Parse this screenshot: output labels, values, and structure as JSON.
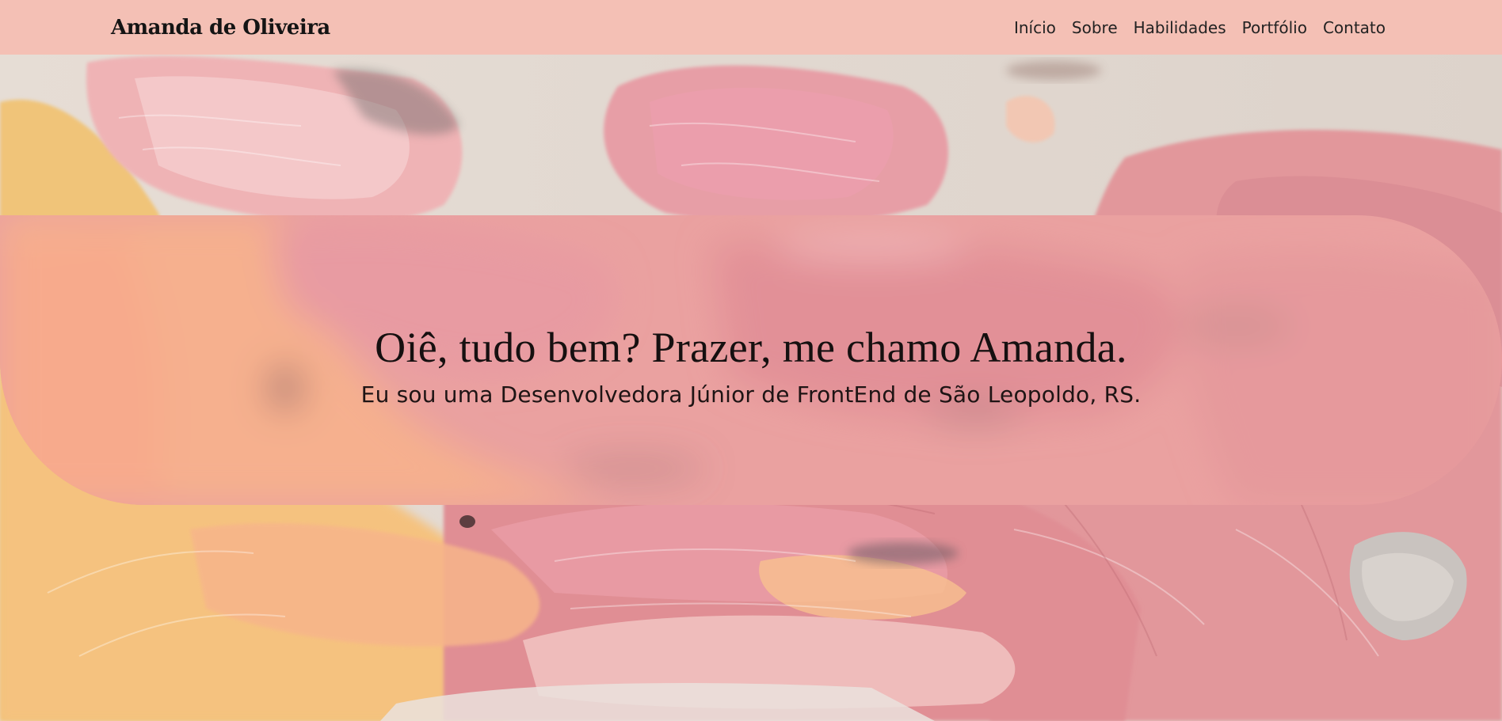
{
  "navbar": {
    "brand": "Amanda de Oliveira",
    "links": [
      {
        "label": "Início"
      },
      {
        "label": "Sobre"
      },
      {
        "label": "Habilidades"
      },
      {
        "label": "Portfólio"
      },
      {
        "label": "Contato"
      }
    ]
  },
  "hero": {
    "title": "Oiê, tudo bem? Prazer, me chamo Amanda.",
    "subtitle": "Eu sou uma Desenvolvedora Júnior de FrontEnd de São Leopoldo, RS."
  },
  "colors": {
    "navbar_bg": "#f4c0b5",
    "paint_pink": "#e39a9c",
    "paint_peach": "#f7b98a",
    "paint_yellow": "#f1c57a",
    "paint_canvas": "#e7ded6"
  }
}
